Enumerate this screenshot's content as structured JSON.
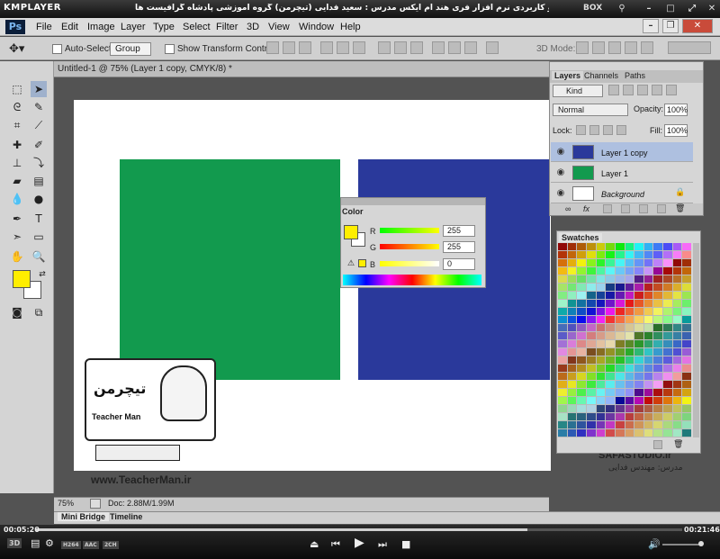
{
  "player": {
    "name": "KMPLAYER",
    "caption": "مجموعه آموزشی جامع ، گام به گام و کاربردی نرم افزار فری هند ام ایکس  مدرس : سعید فدایی (تیچرمن) گروه آموزشی پادشاه گرافیست ها",
    "box_label": "BOX",
    "time_current": "00:05:20",
    "time_total": "00:21:46",
    "progress": 0.76,
    "tags": [
      "3D",
      "H264",
      "AAC",
      "2CH"
    ]
  },
  "photoshop": {
    "logo": "Ps",
    "menu": [
      "File",
      "Edit",
      "Image",
      "Layer",
      "Type",
      "Select",
      "Filter",
      "3D",
      "View",
      "Window",
      "Help"
    ]
  },
  "options_bar": {
    "auto_select_label": "Auto-Select:",
    "auto_select_value": "Group",
    "show_transform_label": "Show Transform Controls",
    "mode_3d_label": "3D Mode:"
  },
  "document": {
    "tab_label": "Untitled-1 @ 75% (Layer 1 copy, CMYK/8) *",
    "zoom": "75%",
    "doc_size": "Doc: 2.88M/1.99M",
    "rect_colors": {
      "left": "#129a4e",
      "right": "#2a399b"
    }
  },
  "bottom_tabs": [
    "Mini Bridge",
    "Timeline"
  ],
  "layers_panel": {
    "tabs": [
      "Layers",
      "Channels",
      "Paths"
    ],
    "kind_label": "Kind",
    "blend_mode": "Normal",
    "opacity_label": "Opacity:",
    "opacity_value": "100%",
    "lock_label": "Lock:",
    "fill_label": "Fill:",
    "fill_value": "100%",
    "layers": [
      {
        "name": "Layer 1 copy",
        "selected": true
      },
      {
        "name": "Layer 1",
        "selected": false
      },
      {
        "name": "Background",
        "selected": false
      }
    ]
  },
  "color_panel": {
    "title": "Color",
    "channels": [
      {
        "label": "R",
        "value": "255"
      },
      {
        "label": "G",
        "value": "255"
      },
      {
        "label": "B",
        "value": "0"
      }
    ],
    "foreground": "#ffee00"
  },
  "swatches_panel": {
    "title": "Swatches"
  },
  "watermark": {
    "url": "www.TeacherMan.ir",
    "logo_text": "تیچرمن",
    "name": "Teacher Man",
    "studio": "SAFASTUDIO.ir",
    "studio_sub": "مدرس: مهندس فدایی"
  }
}
